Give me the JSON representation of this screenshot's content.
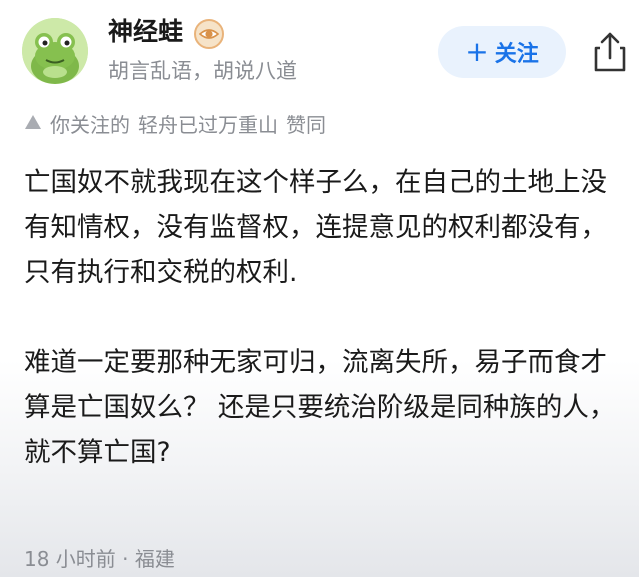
{
  "author": {
    "name": "神经蛙",
    "bio": "胡言乱语，胡说八道",
    "avatar_icon": "frog-avatar-icon",
    "badge_icon": "eye-badge-icon"
  },
  "actions": {
    "follow_label": "关注",
    "follow_icon": "plus-icon",
    "share_icon": "share-icon"
  },
  "liked_by": {
    "prefix": "你关注的",
    "user": "轻舟已过万重山",
    "suffix": "赞同"
  },
  "content": {
    "paragraphs": [
      "亡国奴不就我现在这个样子么，在自己的土地上没有知情权，没有监督权，连提意见的权利都没有，只有执行和交税的权利.",
      "难道一定要那种无家可归，流离失所，易子而食才算是亡国奴么？ 还是只要统治阶级是同种族的人，就不算亡国?"
    ]
  },
  "meta": {
    "time": "18 小时前",
    "separator": "·",
    "location": "福建"
  },
  "colors": {
    "accent": "#1a73e8",
    "follow_bg": "#e9f2fd",
    "muted_text": "#8a8d93"
  }
}
